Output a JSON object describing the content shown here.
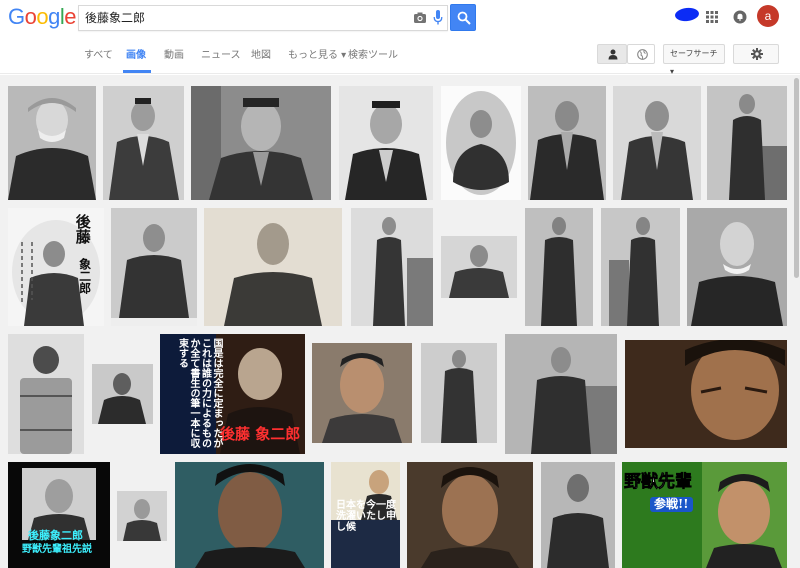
{
  "header": {
    "logo": [
      "G",
      "o",
      "o",
      "g",
      "l",
      "e"
    ],
    "logo_colors": [
      "#4285f4",
      "#ea4335",
      "#fbbc05",
      "#4285f4",
      "#34a853",
      "#ea4335"
    ],
    "search_value": "後藤象二郎",
    "avatar_letter": "a",
    "accent": "#4285f4"
  },
  "tabs": {
    "all": "すべて",
    "images": "画像",
    "videos": "動画",
    "news": "ニュース",
    "maps": "地図",
    "more": "もっと見る ▾",
    "tools": "検索ツール"
  },
  "safe_search": "セーフサーチ ▾",
  "image_texts": {
    "calligraphy_top": "後藤",
    "calligraphy_bottom": "象二郎",
    "poster_name": "後藤 象二郎",
    "poster_tagline": "国是は完全に定まったがこれは誰の力によるものか全て書生の筆一本に収束する",
    "shortcut_name": "後藤象二郎",
    "shortcut_sub": "野獣先輩祖先説",
    "ryoma_text": "日本を今一度洗濯いたし申し候",
    "yaju_title": "野獣先輩",
    "yaju_sub": "参戦!!"
  }
}
